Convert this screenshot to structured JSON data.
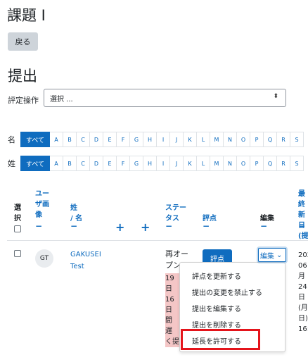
{
  "page": {
    "title": "課題 I",
    "back_label": "戻る",
    "section_title": "提出"
  },
  "grading_action": {
    "label": "評定操作",
    "value": "選択 ...",
    "arrow": "⬍"
  },
  "initials": {
    "first_name_label": "名",
    "last_name_label": "姓",
    "all_label": "すべて",
    "letters": [
      "A",
      "B",
      "C",
      "D",
      "E",
      "F",
      "G",
      "H",
      "I",
      "J",
      "K",
      "L",
      "M",
      "N",
      "O",
      "P",
      "Q",
      "R",
      "S"
    ]
  },
  "table": {
    "headers": {
      "select": [
        "選",
        "択"
      ],
      "userpic": [
        "ユー",
        "ザ画",
        "像"
      ],
      "name": [
        "姓",
        "/ 名"
      ],
      "status": [
        "ステー",
        "タス"
      ],
      "grade": "評点",
      "edit": "編集",
      "lastmod": [
        "最終",
        "新日",
        "(提"
      ],
      "minus": "−",
      "plus": "+"
    },
    "rows": [
      {
        "initials": "GT",
        "firstname": "GAKUSEI",
        "lastname": "Test",
        "status_lines": [
          "再オー",
          "プン"
        ],
        "overdue_lines": [
          "19 日",
          "16 日",
          "間 遅",
          "く提"
        ],
        "grade_button": "評点",
        "edit_label": "編集",
        "edit_arrow": "⌄",
        "lastmod_lines": [
          "202",
          "06月",
          "24日",
          "(月",
          "日)",
          "16:"
        ]
      }
    ]
  },
  "edit_menu": {
    "items": [
      "評点を更新する",
      "提出の変更を禁止する",
      "提出を編集する",
      "提出を削除する",
      "延長を許可する"
    ]
  },
  "colors": {
    "primary": "#0f6cbf",
    "highlight": "#e4141b",
    "overdue_bg": "#f4c6c6"
  }
}
